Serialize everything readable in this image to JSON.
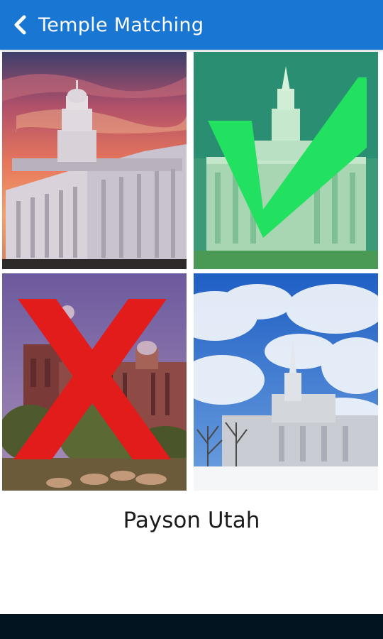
{
  "appbar": {
    "title": "Temple Matching",
    "back_icon": "chevron-left-icon",
    "background": "#1976d2"
  },
  "tiles": [
    {
      "photo": "sunset-temple-photo",
      "state": "none"
    },
    {
      "photo": "green-tinted-temple-photo",
      "state": "correct",
      "overlay_icon": "checkmark-icon",
      "overlay_color": "#22e060"
    },
    {
      "photo": "red-brick-temple-photo",
      "state": "incorrect",
      "overlay_icon": "cross-icon",
      "overlay_color": "#e21b1b"
    },
    {
      "photo": "snowy-temple-photo",
      "state": "none"
    }
  ],
  "prompt": {
    "temple_name": "Payson Utah"
  }
}
